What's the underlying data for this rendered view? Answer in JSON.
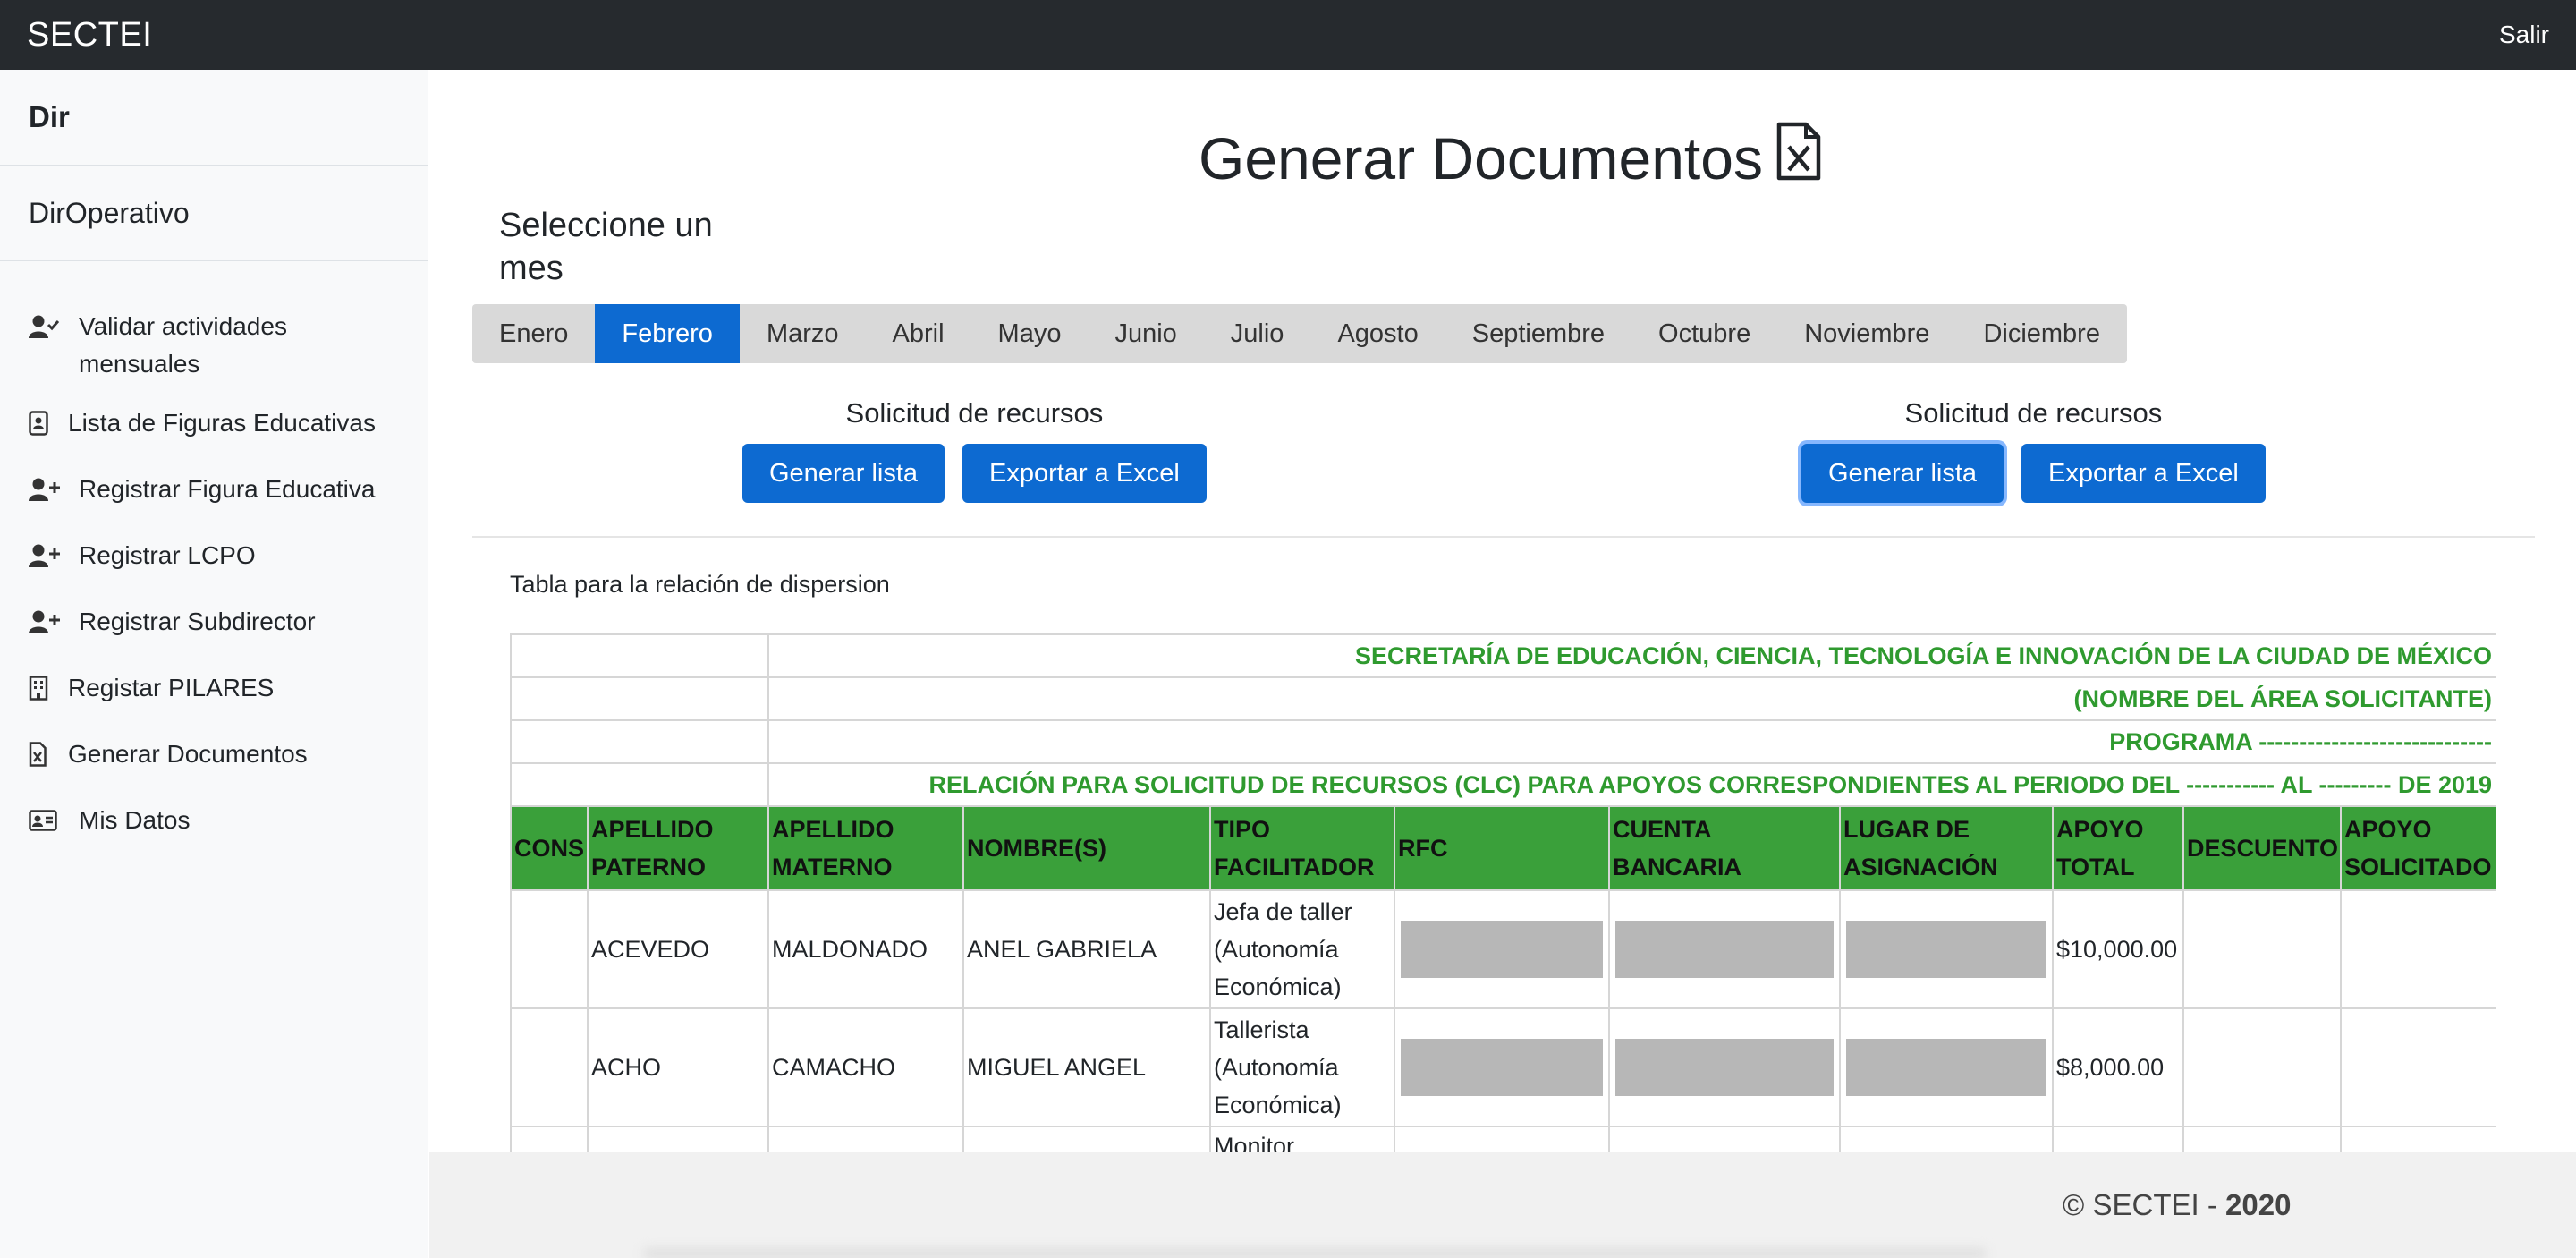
{
  "navbar": {
    "brand": "SECTEI",
    "logout": "Salir"
  },
  "sidebar": {
    "header_title": "Dir",
    "header_subtitle": "DirOperativo",
    "items": [
      {
        "label": "Validar actividades mensuales",
        "icon": "user-check-icon"
      },
      {
        "label": "Lista de Figuras Educativas",
        "icon": "contact-card-icon"
      },
      {
        "label": "Registrar Figura Educativa",
        "icon": "user-plus-icon"
      },
      {
        "label": "Registrar LCPO",
        "icon": "user-plus-icon"
      },
      {
        "label": "Registrar Subdirector",
        "icon": "user-plus-icon"
      },
      {
        "label": "Registar PILARES",
        "icon": "building-icon"
      },
      {
        "label": "Generar Documentos",
        "icon": "file-excel-icon"
      },
      {
        "label": "Mis Datos",
        "icon": "id-card-icon"
      }
    ]
  },
  "main": {
    "title": "Generar Documentos",
    "title_icon": "file-excel-icon",
    "month_prompt": "Seleccione un mes",
    "months": [
      "Enero",
      "Febrero",
      "Marzo",
      "Abril",
      "Mayo",
      "Junio",
      "Julio",
      "Agosto",
      "Septiembre",
      "Octubre",
      "Noviembre",
      "Diciembre"
    ],
    "active_month": "Febrero",
    "request_groups": [
      {
        "label": "Solicitud de recursos",
        "generate": "Generar lista",
        "export": "Exportar a Excel"
      },
      {
        "label": "Solicitud de recursos",
        "generate": "Generar lista",
        "export": "Exportar a Excel"
      }
    ],
    "caption": "Tabla para la relación de dispersion"
  },
  "table": {
    "title_rows": [
      "SECRETARÍA DE EDUCACIÓN, CIENCIA, TECNOLOGÍA E INNOVACIÓN DE LA CIUDAD DE MÉXICO",
      "(NOMBRE DEL ÁREA SOLICITANTE)",
      "PROGRAMA -----------------------------",
      "RELACIÓN PARA SOLICITUD DE RECURSOS (CLC) PARA APOYOS CORRESPONDIENTES AL PERIODO DEL ----------- AL --------- DE 2019"
    ],
    "columns": [
      "CONS",
      "APELLIDO PATERNO",
      "APELLIDO MATERNO",
      "NOMBRE(S)",
      "TIPO FACILITADOR",
      "RFC",
      "CUENTA BANCARIA",
      "LUGAR DE ASIGNACIÓN",
      "APOYO TOTAL",
      "DESCUENTO",
      "APOYO SOLICITADO"
    ],
    "rows": [
      {
        "cons": "",
        "ap_paterno": "ACEVEDO",
        "ap_materno": "MALDONADO",
        "nombre": "ANEL GABRIELA",
        "tipo": "Jefa de taller (Autonomía Económica)",
        "apoyo_total": "$10,000.00",
        "descuento": "",
        "apoyo_solicitado": ""
      },
      {
        "cons": "",
        "ap_paterno": "ACHO",
        "ap_materno": "CAMACHO",
        "nombre": "MIGUEL ANGEL",
        "tipo": "Tallerista (Autonomía Económica)",
        "apoyo_total": "$8,000.00",
        "descuento": "",
        "apoyo_solicitado": ""
      },
      {
        "cons": "",
        "ap_paterno": "",
        "ap_materno": "",
        "nombre": "",
        "tipo": "Monitor",
        "apoyo_total": "",
        "descuento": "",
        "apoyo_solicitado": ""
      }
    ]
  },
  "footer": {
    "copyright": "© SECTEI -",
    "year": "2020"
  },
  "colors": {
    "navbar": "#262a2e",
    "primary": "#0d6ad1",
    "table_header": "#3aa03a",
    "title_text": "#2f9a2f"
  }
}
